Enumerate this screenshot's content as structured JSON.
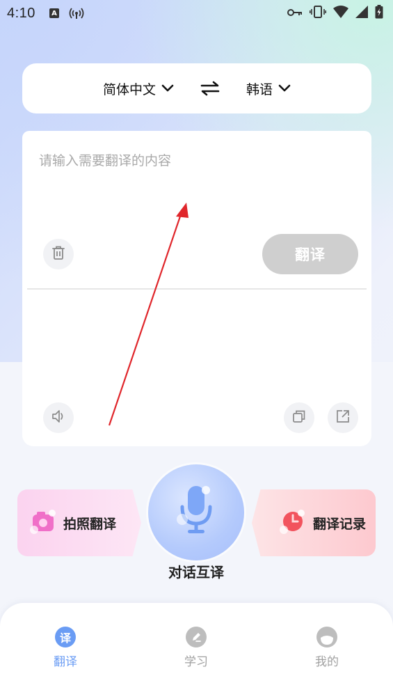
{
  "status_bar": {
    "time": "4:10",
    "a_badge": "A"
  },
  "language_bar": {
    "source_language": "简体中文",
    "target_language": "韩语"
  },
  "input": {
    "placeholder": "请输入需要翻译的内容",
    "value": ""
  },
  "actions": {
    "translate_label": "翻译"
  },
  "features": {
    "photo_label": "拍照翻译",
    "dialogue_label": "对话互译",
    "history_label": "翻译记录"
  },
  "bottom_nav": {
    "items": [
      {
        "label": "翻译",
        "icon": "translate-icon",
        "glyph": "译",
        "active": true
      },
      {
        "label": "学习",
        "icon": "pen-icon",
        "active": false
      },
      {
        "label": "我的",
        "icon": "profile-icon",
        "active": false
      }
    ]
  },
  "colors": {
    "accent": "#6a9cf4",
    "annotation_arrow": "#e0262b",
    "translate_button_disabled": "#cfcfcf"
  }
}
